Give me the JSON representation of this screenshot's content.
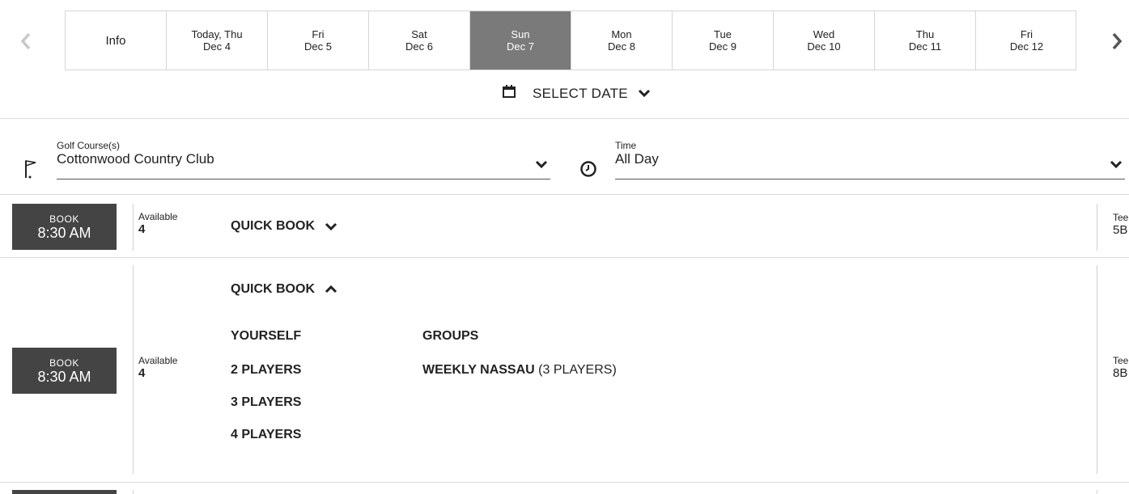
{
  "date_nav": {
    "info_label": "Info",
    "dates": [
      {
        "day": "Today, Thu",
        "date": "Dec 4"
      },
      {
        "day": "Fri",
        "date": "Dec 5"
      },
      {
        "day": "Sat",
        "date": "Dec 6"
      },
      {
        "day": "Sun",
        "date": "Dec 7",
        "selected": true
      },
      {
        "day": "Mon",
        "date": "Dec 8"
      },
      {
        "day": "Tue",
        "date": "Dec 9"
      },
      {
        "day": "Wed",
        "date": "Dec 10"
      },
      {
        "day": "Thu",
        "date": "Dec 11"
      },
      {
        "day": "Fri",
        "date": "Dec 12"
      }
    ],
    "select_date_label": "SELECT DATE"
  },
  "filters": {
    "course_label": "Golf Course(s)",
    "course_value": "Cottonwood Country Club",
    "time_label": "Time",
    "time_value": "All Day"
  },
  "tee_times": [
    {
      "book_label": "BOOK",
      "time": "8:30 AM",
      "available_label": "Available",
      "available": "4",
      "quick_book_label": "QUICK BOOK",
      "tee_label": "Tee",
      "tee_value": "5B"
    },
    {
      "book_label": "BOOK",
      "time": "8:30 AM",
      "available_label": "Available",
      "available": "4",
      "quick_book_label": "QUICK BOOK",
      "tee_label": "Tee",
      "tee_value": "8B",
      "quick_book_options": {
        "yourself": "YOURSELF",
        "players": [
          "2 PLAYERS",
          "3 PLAYERS",
          "4 PLAYERS"
        ],
        "groups_label": "GROUPS",
        "group_name": "WEEKLY NASSAU",
        "group_count": "(3 PLAYERS)"
      }
    }
  ],
  "colors": {
    "selected_date_bg": "#7a7a7a",
    "book_button_bg": "#444444"
  }
}
